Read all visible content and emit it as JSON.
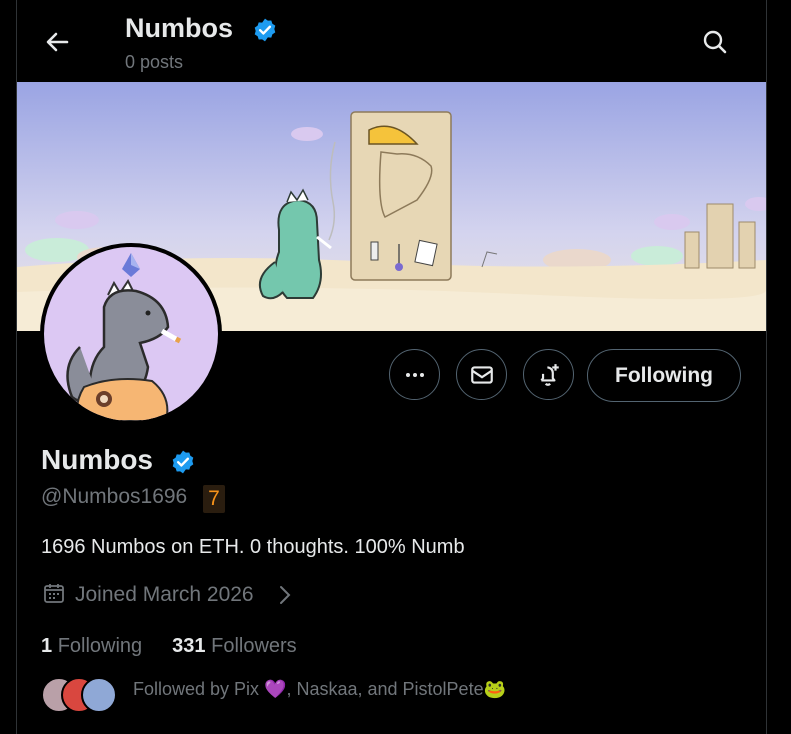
{
  "header": {
    "name": "Numbos",
    "posts": "0 posts"
  },
  "actions": {
    "following_label": "Following"
  },
  "profile": {
    "name": "Numbos",
    "handle": "@Numbos1696",
    "handle_tag": "7",
    "bio": "1696 Numbos on ETH. 0 thoughts. 100% Numb",
    "joined": "Joined March 2026",
    "following_count": "1",
    "following_label": "Following",
    "followers_count": "331",
    "followers_label": "Followers",
    "followed_by": "Followed by Pix 💜, Naskaa, and PistolPete🐸"
  },
  "icons": {
    "back": "arrow-left-icon",
    "search": "search-icon",
    "verified": "verified-badge-icon",
    "more": "more-horizontal-icon",
    "message": "envelope-icon",
    "notify": "bell-plus-icon",
    "calendar": "calendar-icon",
    "chevron": "chevron-right-icon"
  },
  "colors": {
    "verified": "#1d9bf0",
    "background": "#000000",
    "secondary_text": "#71767b",
    "tag": "#f7931a"
  }
}
